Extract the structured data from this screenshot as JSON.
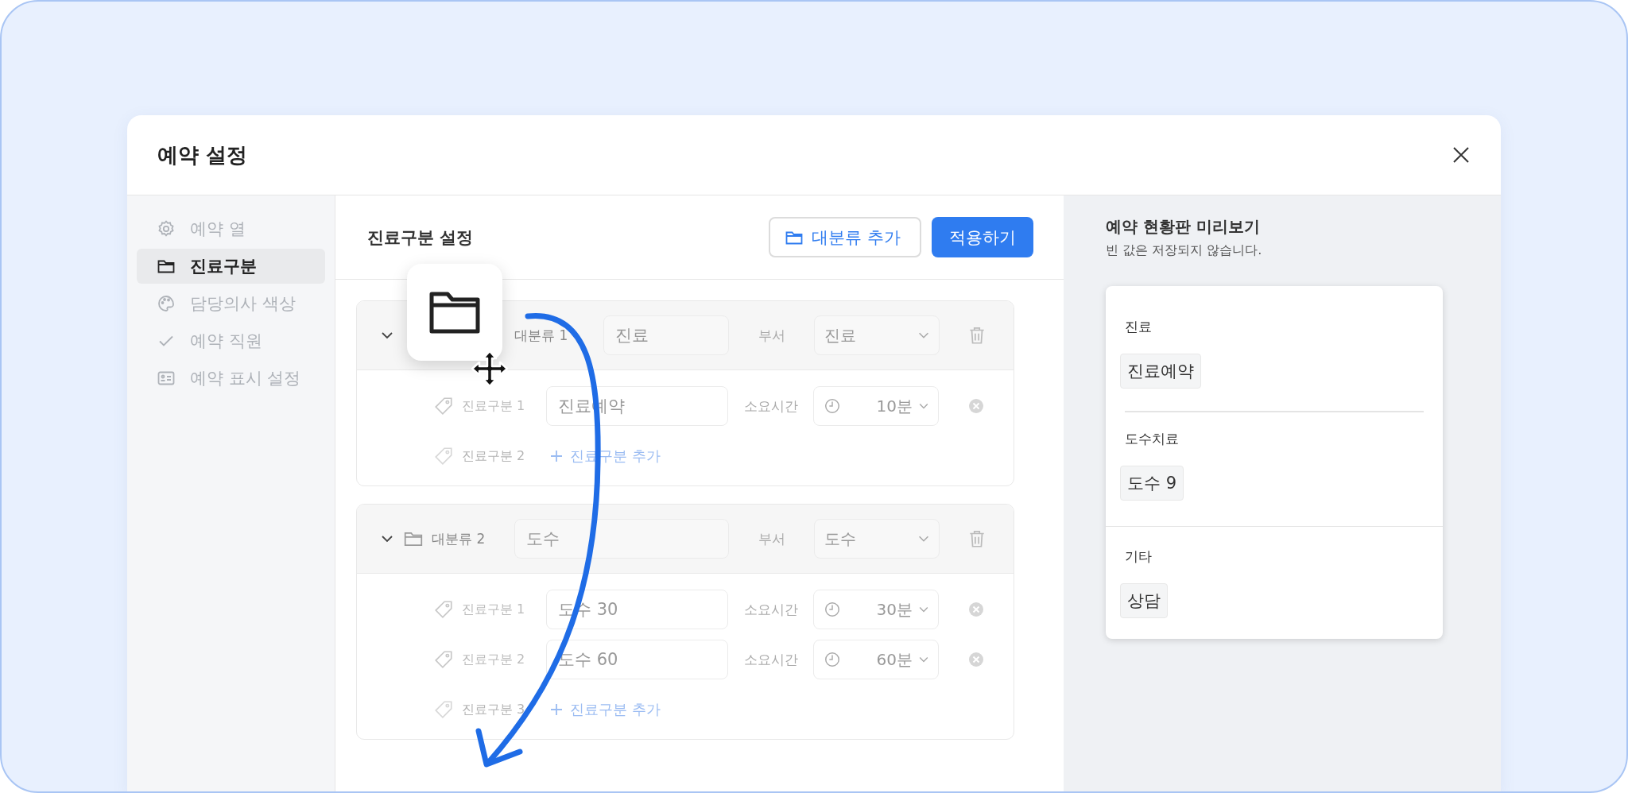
{
  "dialog": {
    "title": "예약 설정"
  },
  "sidebar": {
    "items": [
      {
        "label": "예약 열",
        "kind": "gear",
        "selected": false
      },
      {
        "label": "진료구분",
        "kind": "folder",
        "selected": true
      },
      {
        "label": "담당의사 색상",
        "kind": "palette",
        "selected": false
      },
      {
        "label": "예약 직원",
        "kind": "check",
        "selected": false
      },
      {
        "label": "예약 표시 설정",
        "kind": "card",
        "selected": false
      }
    ]
  },
  "editor": {
    "title": "진료구분 설정",
    "add_group_button": "대분류 추가",
    "apply_button": "적용하기",
    "groups": [
      {
        "expanded": true,
        "dragging": true,
        "label": "대분류 1",
        "name": "진료",
        "dept_label": "부서",
        "dept": "진료",
        "items": [
          {
            "label": "진료구분 1",
            "name": "진료예약",
            "duration_label": "소요시간",
            "duration": "10분"
          }
        ],
        "add_row": {
          "label": "진료구분 2",
          "action": "진료구분 추가"
        }
      },
      {
        "expanded": true,
        "dragging": false,
        "label": "대분류 2",
        "name": "도수",
        "dept_label": "부서",
        "dept": "도수",
        "items": [
          {
            "label": "진료구분 1",
            "name": "도수 30",
            "duration_label": "소요시간",
            "duration": "30분"
          },
          {
            "label": "진료구분 2",
            "name": "도수 60",
            "duration_label": "소요시간",
            "duration": "60분"
          }
        ],
        "add_row": {
          "label": "진료구분 3",
          "action": "진료구분 추가"
        }
      }
    ]
  },
  "preview": {
    "title": "예약 현황판 미리보기",
    "subtitle": "빈 값은 저장되지 않습니다.",
    "sections": [
      {
        "heading": "진료",
        "chips": [
          "진료예약"
        ],
        "divider_inset": true
      },
      {
        "heading": "도수치료",
        "chips": [
          "도수 9"
        ],
        "divider_inset": false
      },
      {
        "heading": "기타",
        "chips": [
          "상담"
        ]
      }
    ]
  }
}
